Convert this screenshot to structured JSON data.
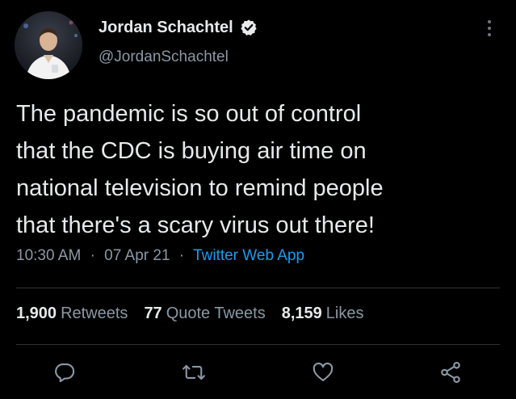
{
  "author": {
    "display_name": "Jordan Schachtel",
    "handle": "@JordanSchachtel",
    "verified": true
  },
  "tweet": {
    "lines": [
      "The pandemic is so out of control",
      "that the CDC is buying air time on",
      "national television to remind people",
      "that there's a scary virus out there!"
    ],
    "time": "10:30 AM",
    "separator": "·",
    "date": "07 Apr 21",
    "source": "Twitter Web App"
  },
  "stats": {
    "retweets_count": "1,900",
    "retweets_label": "Retweets",
    "quotes_count": "77",
    "quotes_label": "Quote Tweets",
    "likes_count": "8,159",
    "likes_label": "Likes"
  },
  "icons": {
    "verified": "verified-badge-icon",
    "more": "more-vertical-icon",
    "reply": "reply-icon",
    "retweet": "retweet-icon",
    "like": "heart-icon",
    "share": "share-icon"
  },
  "colors": {
    "background": "#000000",
    "text": "#e7e9ea",
    "secondary": "#8b98a5",
    "link": "#1d9bf0",
    "divider": "#2f3336"
  }
}
